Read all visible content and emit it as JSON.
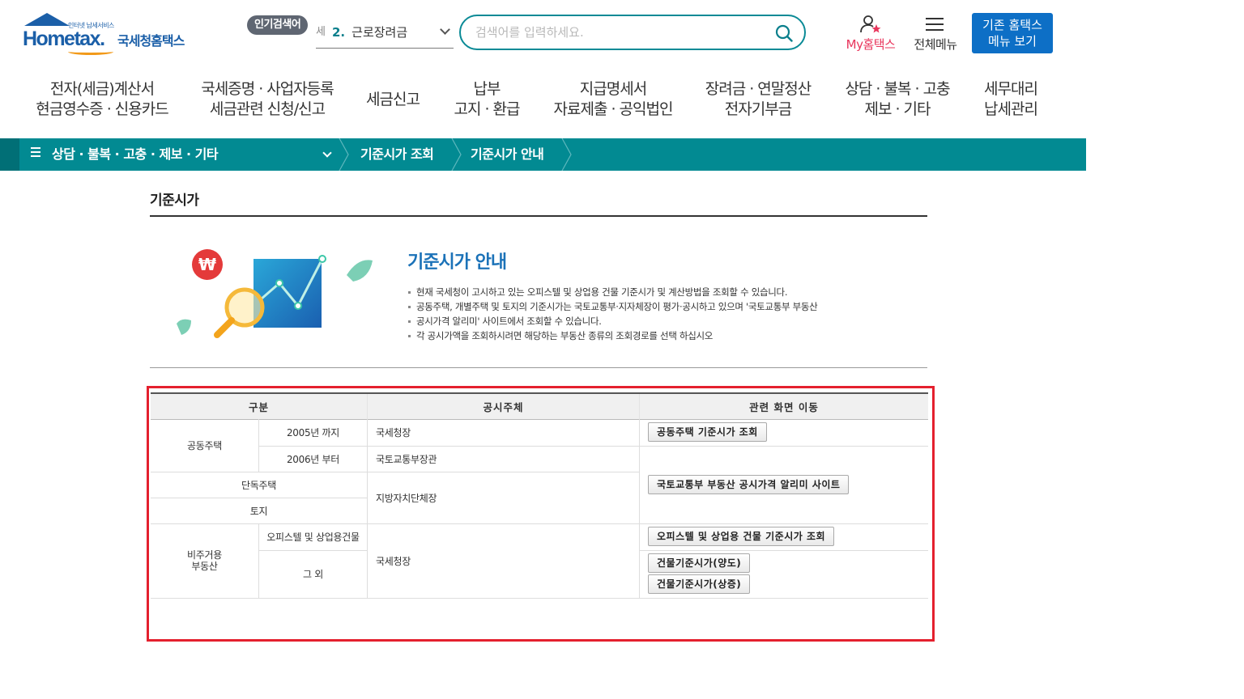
{
  "header": {
    "logo_top_text": "인터넷 납세서비스",
    "logo_text": "Hometax.",
    "logo_kr": "국세청홈택스",
    "popular_badge": "인기검색어",
    "popular_prev": "세",
    "popular_num": "2.",
    "popular_term": "근로장려금",
    "search_placeholder": "검색어를 입력하세요.",
    "my_hometax": "My홈택스",
    "all_menu": "전체메뉴",
    "old_hometax_line1": "기존 홈택스",
    "old_hometax_line2": "메뉴 보기"
  },
  "gnb": [
    {
      "line1": "전자(세금)계산서",
      "line2": "현금영수증 · 신용카드"
    },
    {
      "line1": "국세증명 · 사업자등록",
      "line2": "세금관련 신청/신고"
    },
    {
      "line1": "세금신고",
      "line2": ""
    },
    {
      "line1": "납부",
      "line2": "고지 · 환급"
    },
    {
      "line1": "지급명세서",
      "line2": "자료제출 · 공익법인"
    },
    {
      "line1": "장려금 · 연말정산",
      "line2": "전자기부금"
    },
    {
      "line1": "상담 · 불복 · 고충",
      "line2": "제보 · 기타"
    },
    {
      "line1": "세무대리",
      "line2": "납세관리"
    }
  ],
  "breadcrumb": {
    "main": "상담 · 불복 · 고충 · 제보 · 기타",
    "item1": "기준시가 조회",
    "item2": "기준시가 안내"
  },
  "page": {
    "title": "기준시가",
    "guide_heading": "기준시가 안내",
    "guide_items": [
      "현재 국세청이 고시하고 있는 오피스텔 및 상업용 건물 기준시가 및 계산방법을 조회할 수 있습니다.",
      "공동주택, 개별주택 및 토지의 기준시가는 국토교통부·지자체장이 평가·공시하고 있으며 '국토교통부 부동산",
      "공시가격 알리미' 사이트에서 조회할 수 있습니다.",
      "각 공시가액을 조회하시려면 해당하는 부동산 종류의 조회경로를 선택 하십시오"
    ]
  },
  "table": {
    "headers": {
      "category": "구분",
      "authority": "공시주체",
      "link": "관련 화면 이동"
    },
    "cells": {
      "apartment": "공동주택",
      "until_2005": "2005년 까지",
      "from_2006": "2006년 부터",
      "detached": "단독주택",
      "land": "토지",
      "non_residential": "비주거용\n부동산",
      "officetel": "오피스텔 및 상업용건물",
      "others": "그 외",
      "nts": "국세청장",
      "molit": "국토교통부장관",
      "local": "지방자치단체장",
      "nts2": "국세청장"
    },
    "buttons": {
      "apartment_lookup": "공동주택 기준시가 조회",
      "molit_site": "국토교통부 부동산 공시가격 알리미 사이트",
      "officetel_lookup": "오피스텔 및 상업용 건물 기준시가 조회",
      "building_transfer": "건물기준시가(양도)",
      "building_inherit": "건물기준시가(상증)"
    }
  },
  "colors": {
    "brand_blue": "#1b5fa8",
    "teal": "#028a92",
    "highlight_red": "#e4202e",
    "pink": "#e8345b"
  }
}
